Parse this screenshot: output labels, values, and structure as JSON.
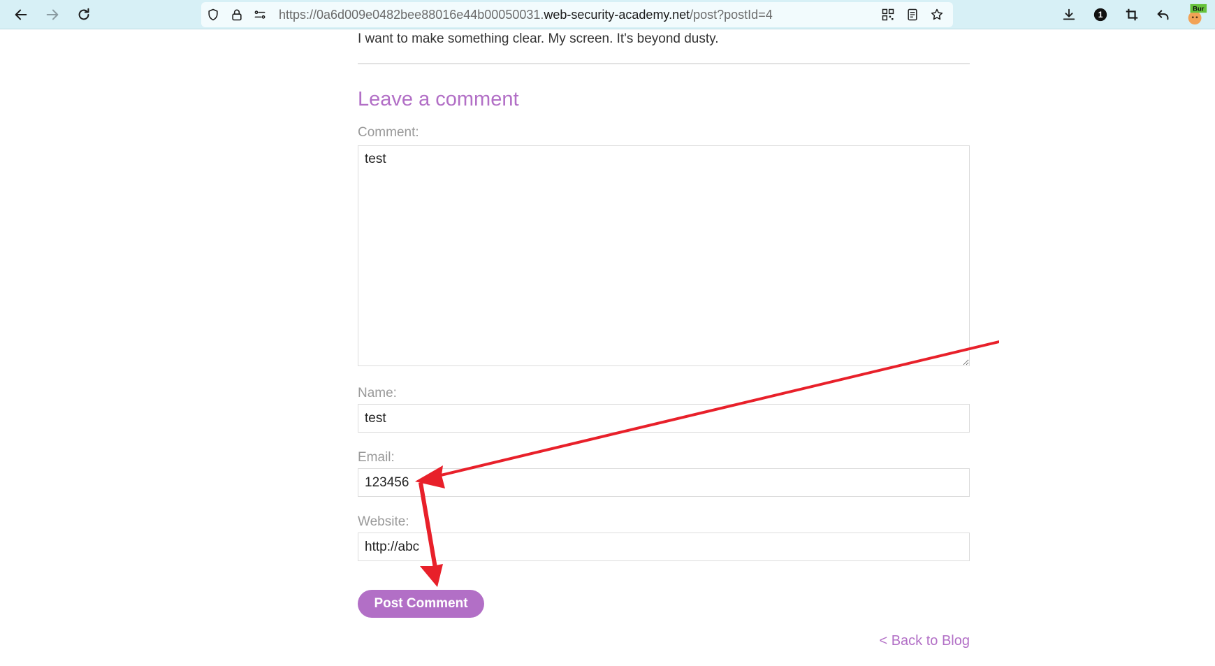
{
  "browser": {
    "url_prefix": "https://0a6d009e0482bee88016e44b00050031.",
    "url_host": "web-security-academy.net",
    "url_path": "/post?postId=4",
    "extension_badge": "Bur",
    "notification_count": "1"
  },
  "post": {
    "last_line": "I want to make something clear. My screen. It's beyond dusty."
  },
  "comment_form": {
    "heading": "Leave a comment",
    "comment_label": "Comment:",
    "comment_value": "test",
    "name_label": "Name:",
    "name_value": "test",
    "email_label": "Email:",
    "email_value": "123456",
    "website_label": "Website:",
    "website_value": "http://abc",
    "submit_label": "Post Comment"
  },
  "back_link": "< Back to Blog",
  "colors": {
    "accent": "#b26fc6",
    "annotation_arrow": "#e8202a",
    "toolbar_bg": "#d7f0f6"
  },
  "icons": [
    "back-arrow-icon",
    "forward-arrow-icon",
    "reload-icon",
    "shield-icon",
    "lock-icon",
    "permissions-icon",
    "qr-code-icon",
    "reader-view-icon",
    "bookmark-star-icon",
    "download-icon",
    "notification-icon",
    "crop-icon",
    "undo-icon",
    "burp-extension-icon"
  ]
}
